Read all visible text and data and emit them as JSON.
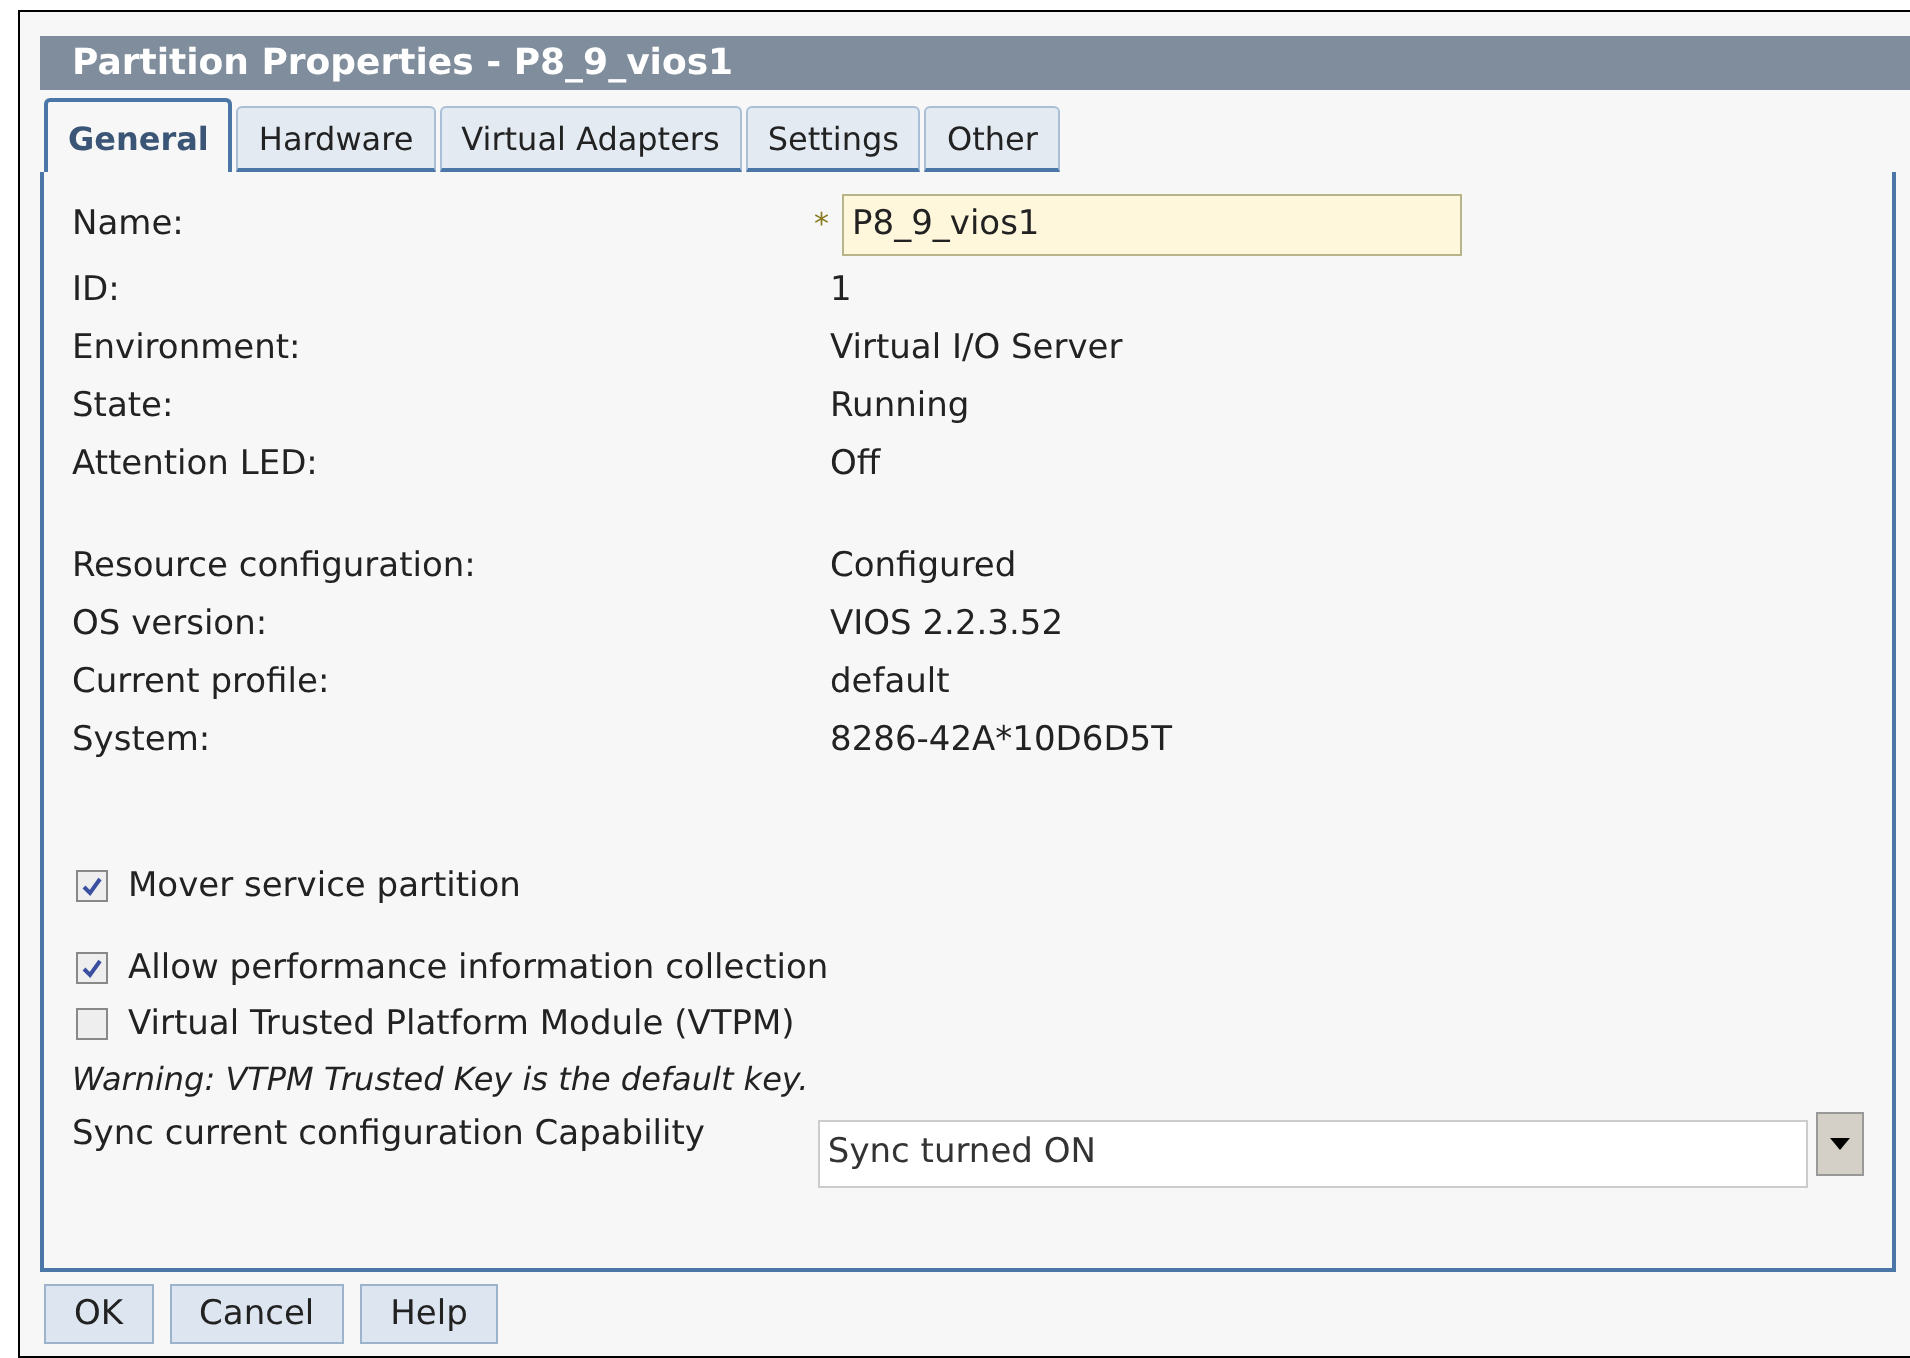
{
  "window": {
    "title": "Partition Properties - P8_9_vios1"
  },
  "tabs": [
    {
      "label": "General",
      "selected": true
    },
    {
      "label": "Hardware",
      "selected": false
    },
    {
      "label": "Virtual Adapters",
      "selected": false
    },
    {
      "label": "Settings",
      "selected": false
    },
    {
      "label": "Other",
      "selected": false
    }
  ],
  "name_field": {
    "label": "Name:",
    "required_mark": "*",
    "value": "P8_9_vios1"
  },
  "groups": [
    [
      {
        "label": "ID:",
        "value": "1"
      },
      {
        "label": "Environment:",
        "value": "Virtual I/O Server"
      },
      {
        "label": "State:",
        "value": "Running"
      },
      {
        "label": "Attention LED:",
        "value": "Off"
      }
    ],
    [
      {
        "label": "Resource configuration:",
        "value": "Configured"
      },
      {
        "label": "OS version:",
        "value": "VIOS 2.2.3.52"
      },
      {
        "label": "Current profile:",
        "value": "default"
      },
      {
        "label": "System:",
        "value": "8286-42A*10D6D5T"
      }
    ]
  ],
  "checkbox_groups": [
    [
      {
        "label": "Mover service partition",
        "checked": true
      }
    ],
    [
      {
        "label": "Allow performance information collection",
        "checked": true
      },
      {
        "label": "Virtual Trusted Platform Module (VTPM)",
        "checked": false
      }
    ]
  ],
  "warning": "Warning: VTPM Trusted Key is the default key.",
  "sync": {
    "label": "Sync current configuration Capability",
    "value": "Sync turned ON"
  },
  "buttons": [
    "OK",
    "Cancel",
    "Help"
  ]
}
